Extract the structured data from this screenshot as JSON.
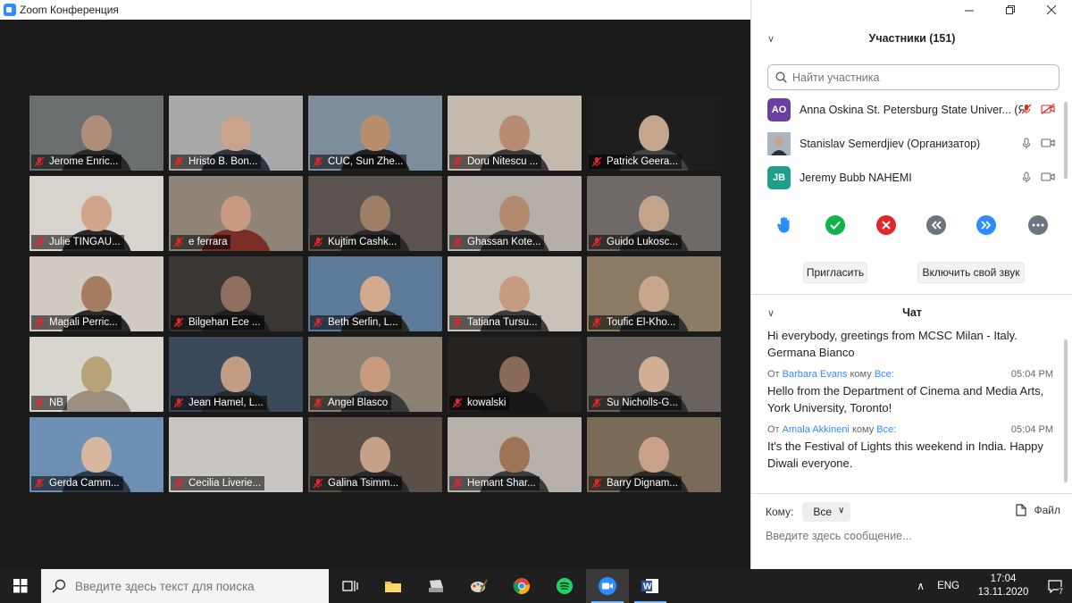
{
  "window": {
    "title": "Zoom Конференция"
  },
  "tiles": [
    {
      "name": "Jerome Enric...",
      "bg": "#6b6f70",
      "face": "#b08f7a",
      "body": "#2a2a2a"
    },
    {
      "name": "Hristo B. Bon...",
      "bg": "#a8a8a8",
      "face": "#c9a38b",
      "body": "#2f3540"
    },
    {
      "name": "CUC, Sun Zhe...",
      "bg": "#7c8d9b",
      "face": "#b78d6c",
      "body": "#222222"
    },
    {
      "name": "Doru Nitescu ...",
      "bg": "#c3b9ad",
      "face": "#b88c72",
      "body": "#3a3a3a"
    },
    {
      "name": "Patrick Geera...",
      "bg": "#1e1e1e",
      "face": "#c6a58d",
      "body": "#444444"
    },
    {
      "name": "Julie TINGAU...",
      "bg": "#d8d3cc",
      "face": "#d0a58a",
      "body": "#2a2a2a"
    },
    {
      "name": "e ferrara",
      "bg": "#8f8477",
      "face": "#c99a80",
      "body": "#7a2e26"
    },
    {
      "name": "Kujtim Cashk...",
      "bg": "#5b5450",
      "face": "#9e8068",
      "body": "#2a2a2a"
    },
    {
      "name": "Ghassan Kote...",
      "bg": "#b5afa8",
      "face": "#b28a6d",
      "body": "#3d3d3d"
    },
    {
      "name": "Guido Lukosc...",
      "bg": "#6f6a66",
      "face": "#c5a48c",
      "body": "#303030"
    },
    {
      "name": "Magali Perric...",
      "bg": "#d0cac2",
      "face": "#a77d62",
      "body": "#2a2a2a"
    },
    {
      "name": "Bilgehan Ece ...",
      "bg": "#3a3633",
      "face": "#8f7060",
      "body": "#1f1f1f"
    },
    {
      "name": "Beth Serlin, L...",
      "bg": "#5e7a99",
      "face": "#d3aa8e",
      "body": "#2b2b2b"
    },
    {
      "name": "Tatiana Tursu...",
      "bg": "#c9c2b8",
      "face": "#c59c82",
      "body": "#3c3c3c"
    },
    {
      "name": "Toufic El-Kho...",
      "bg": "#8b7b65",
      "face": "#c8a68e",
      "body": "#303030"
    },
    {
      "name": "NB",
      "bg": "#d9d6d0",
      "face": "#b8a27a",
      "body": "#9a8f80"
    },
    {
      "name": "Jean Hamel, L...",
      "bg": "#3b4a5a",
      "face": "#c29c84",
      "body": "#2a2a2a"
    },
    {
      "name": "Angel Blasco",
      "bg": "#8a8074",
      "face": "#c89b7e",
      "body": "#3a3a3a"
    },
    {
      "name": "kowalski",
      "bg": "#252220",
      "face": "#8a6a58",
      "body": "#181818"
    },
    {
      "name": "Su Nicholls-G...",
      "bg": "#6a625c",
      "face": "#d2ae94",
      "body": "#2f2f2f"
    },
    {
      "name": "Gerda Camm...",
      "bg": "#6d8fb4",
      "face": "#d7b7a0",
      "body": "#2a3a4a"
    },
    {
      "name": "Cecilia Liverie...",
      "bg": "#c9c6c2",
      "face": "#c9c6c2",
      "body": "#c9c6c2"
    },
    {
      "name": "Galina Tsimm...",
      "bg": "#5a5048",
      "face": "#c7a089",
      "body": "#2a2a2a"
    },
    {
      "name": "Hemant Shar...",
      "bg": "#b7b1a9",
      "face": "#9e7456",
      "body": "#3a3a3a"
    },
    {
      "name": "Barry Dignam...",
      "bg": "#7a6a58",
      "face": "#c9a189",
      "body": "#2a2a2a"
    }
  ],
  "participants_panel": {
    "title": "Участники (151)",
    "search_placeholder": "Найти участника",
    "list": [
      {
        "initials": "AO",
        "avatar_color": "#6b3fa0",
        "name": "Anna Oskina St. Petersburg State Univer... (Я)"
      },
      {
        "initials": "",
        "avatar_color": "#7a8a9a",
        "name": "Stanislav Semerdjiev (Организатор)"
      },
      {
        "initials": "JB",
        "avatar_color": "#1f9e8a",
        "name": "Jeremy Bubb NAHEMI"
      }
    ],
    "invite_label": "Пригласить",
    "unmute_label": "Включить свой звук"
  },
  "chat": {
    "title": "Чат",
    "messages": [
      {
        "from_label": "",
        "sender": "",
        "to_label": "",
        "recipient": "",
        "time": "",
        "text": "Hi everybody, greetings from MCSC Milan - Italy. Germana Bianco"
      },
      {
        "from_label": "От",
        "sender": "Barbara Evans",
        "to_label": "кому",
        "recipient": "Все:",
        "time": "05:04 PM",
        "text": "Hello from the Department of Cinema and Media Arts, York University, Toronto!"
      },
      {
        "from_label": "От",
        "sender": "Amala Akkineni",
        "to_label": "кому",
        "recipient": "Все:",
        "time": "05:04 PM",
        "text": "It's the Festival of Lights this weekend in India. Happy Diwali everyone."
      }
    ],
    "to_label": "Кому:",
    "to_value": "Все",
    "file_label": "Файл",
    "input_placeholder": "Введите здесь сообщение..."
  },
  "taskbar": {
    "search_placeholder": "Введите здесь текст для поиска",
    "lang": "ENG",
    "time": "17:04",
    "date": "13.11.2020",
    "notifications": "7"
  },
  "colors": {
    "accent": "#2d8cff",
    "muted_red": "#e02828",
    "green": "#12b24a"
  }
}
